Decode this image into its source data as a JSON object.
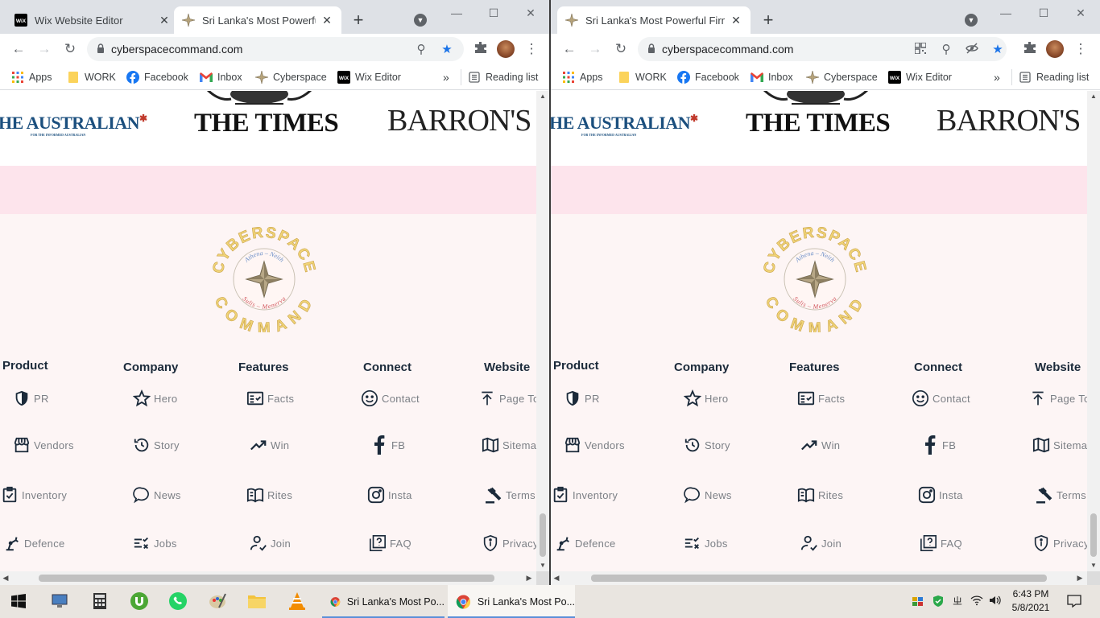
{
  "windows": [
    {
      "tabs": [
        {
          "title": "Wix Website Editor",
          "active": false,
          "icon": "wix-icon"
        },
        {
          "title": "Sri Lanka's Most Powerful F",
          "active": true,
          "icon": "compass-star-icon"
        }
      ],
      "url": "cyberspacecommand.com"
    },
    {
      "tabs": [
        {
          "title": "Sri Lanka's Most Powerful Firm | C",
          "active": true,
          "icon": "compass-star-icon"
        }
      ],
      "url": "cyberspacecommand.com"
    }
  ],
  "bookmarks": [
    {
      "label": "Apps",
      "icon": "apps-grid-icon"
    },
    {
      "label": "WORK",
      "icon": "folder-icon"
    },
    {
      "label": "Facebook",
      "icon": "facebook-icon"
    },
    {
      "label": "Inbox",
      "icon": "gmail-icon"
    },
    {
      "label": "Cyberspace",
      "icon": "compass-star-icon"
    },
    {
      "label": "Wix Editor",
      "icon": "wix-icon"
    }
  ],
  "reading_list": "Reading list",
  "press": {
    "australian": "HE AUSTRALIAN",
    "australian_sub": "FOR THE INFORMED AUSTRALIAN",
    "times": "THE TIMES",
    "barrons": "BARRON'S"
  },
  "emblem": {
    "top": "CYBERSPACE",
    "bottom": "COMMAND",
    "inner_top": "Athena – Neith",
    "inner_bottom": "Sulis – Menerva"
  },
  "footer": {
    "columns": [
      {
        "heading": "Product",
        "items": [
          {
            "label": "PR",
            "icon": "shield-icon"
          },
          {
            "label": "Vendors",
            "icon": "storefront-icon"
          },
          {
            "label": "Inventory",
            "icon": "clipboard-check-icon"
          },
          {
            "label": "Defence",
            "icon": "robotic-arm-icon"
          }
        ]
      },
      {
        "heading": "Company",
        "items": [
          {
            "label": "Hero",
            "icon": "star-icon"
          },
          {
            "label": "Story",
            "icon": "history-icon"
          },
          {
            "label": "News",
            "icon": "chat-bubble-icon"
          },
          {
            "label": "Jobs",
            "icon": "checklist-icon"
          }
        ]
      },
      {
        "heading": "Features",
        "items": [
          {
            "label": "Facts",
            "icon": "fact-check-icon"
          },
          {
            "label": "Win",
            "icon": "trending-up-icon"
          },
          {
            "label": "Rites",
            "icon": "open-book-icon"
          },
          {
            "label": "Join",
            "icon": "person-check-icon"
          }
        ]
      },
      {
        "heading": "Connect",
        "items": [
          {
            "label": "Contact",
            "icon": "smiley-icon"
          },
          {
            "label": "FB",
            "icon": "facebook-f-icon"
          },
          {
            "label": "Insta",
            "icon": "instagram-icon"
          },
          {
            "label": "FAQ",
            "icon": "help-box-icon"
          }
        ]
      },
      {
        "heading": "Website",
        "items": [
          {
            "label": "Page To",
            "icon": "arrow-to-top-icon"
          },
          {
            "label": "Sitemap",
            "icon": "map-icon"
          },
          {
            "label": "Terms",
            "icon": "gavel-icon"
          },
          {
            "label": "Privacy",
            "icon": "privacy-shield-icon"
          }
        ]
      }
    ]
  },
  "taskbar": {
    "apps": [
      {
        "label": "Sri Lanka's Most Po...",
        "selected": false
      },
      {
        "label": "Sri Lanka's Most Po...",
        "selected": true
      }
    ],
    "time": "6:43 PM",
    "date": "5/8/2021"
  },
  "colors": {
    "page_bg": "#fdf5f5",
    "pink_band": "#fde4ec",
    "heading": "#1b2a3a",
    "link_gray": "#7b7f85",
    "star_blue": "#1a73e8"
  }
}
